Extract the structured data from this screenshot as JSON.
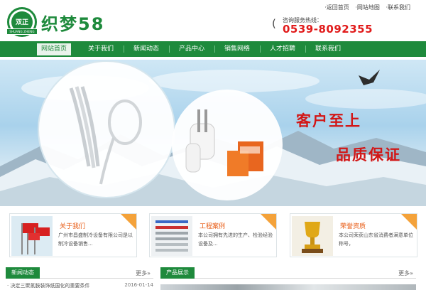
{
  "header": {
    "logo_mark_text": "双正",
    "logo_mark_band": "SHUANG ZHENG",
    "logo_text": "织梦58",
    "top_links": [
      "·返回首页",
      "·网站地图",
      "·联系我们"
    ],
    "hotline_label": "咨询服务热线：",
    "hotline_number": "0539-8092355"
  },
  "nav": {
    "items": [
      "网站首页",
      "关于我们",
      "新闻动态",
      "产品中心",
      "销售网络",
      "人才招聘",
      "联系我们"
    ],
    "active_index": 0
  },
  "banner": {
    "slogan_1": "客户至上",
    "slogan_2": "品质保证",
    "slide_count": 3,
    "active_slide": 1
  },
  "features": [
    {
      "title": "关于我们",
      "desc": "广州市昌盛制冷设备有限公司是以制冷设备销售..."
    },
    {
      "title": "工程案例",
      "desc": "本公司拥有先进的生产、检验经验设备及..."
    },
    {
      "title": "荣誉资质",
      "desc": "本公司荣获山东省消费者满意单位称号，"
    }
  ],
  "sections": {
    "news": {
      "title": "新闻动态",
      "more": "更多»"
    },
    "products": {
      "title": "产品展示",
      "more": "更多»"
    }
  },
  "news_items": [
    {
      "title": "· 决定三聚氰胺装饰纸国化的重要条件",
      "date": "2016-01-14"
    }
  ],
  "colors": {
    "brand_green": "#1e8a3c",
    "hotline_red": "#e11b1b",
    "feature_title_orange": "#e85a12",
    "ribbon_orange": "#f4a23a"
  }
}
